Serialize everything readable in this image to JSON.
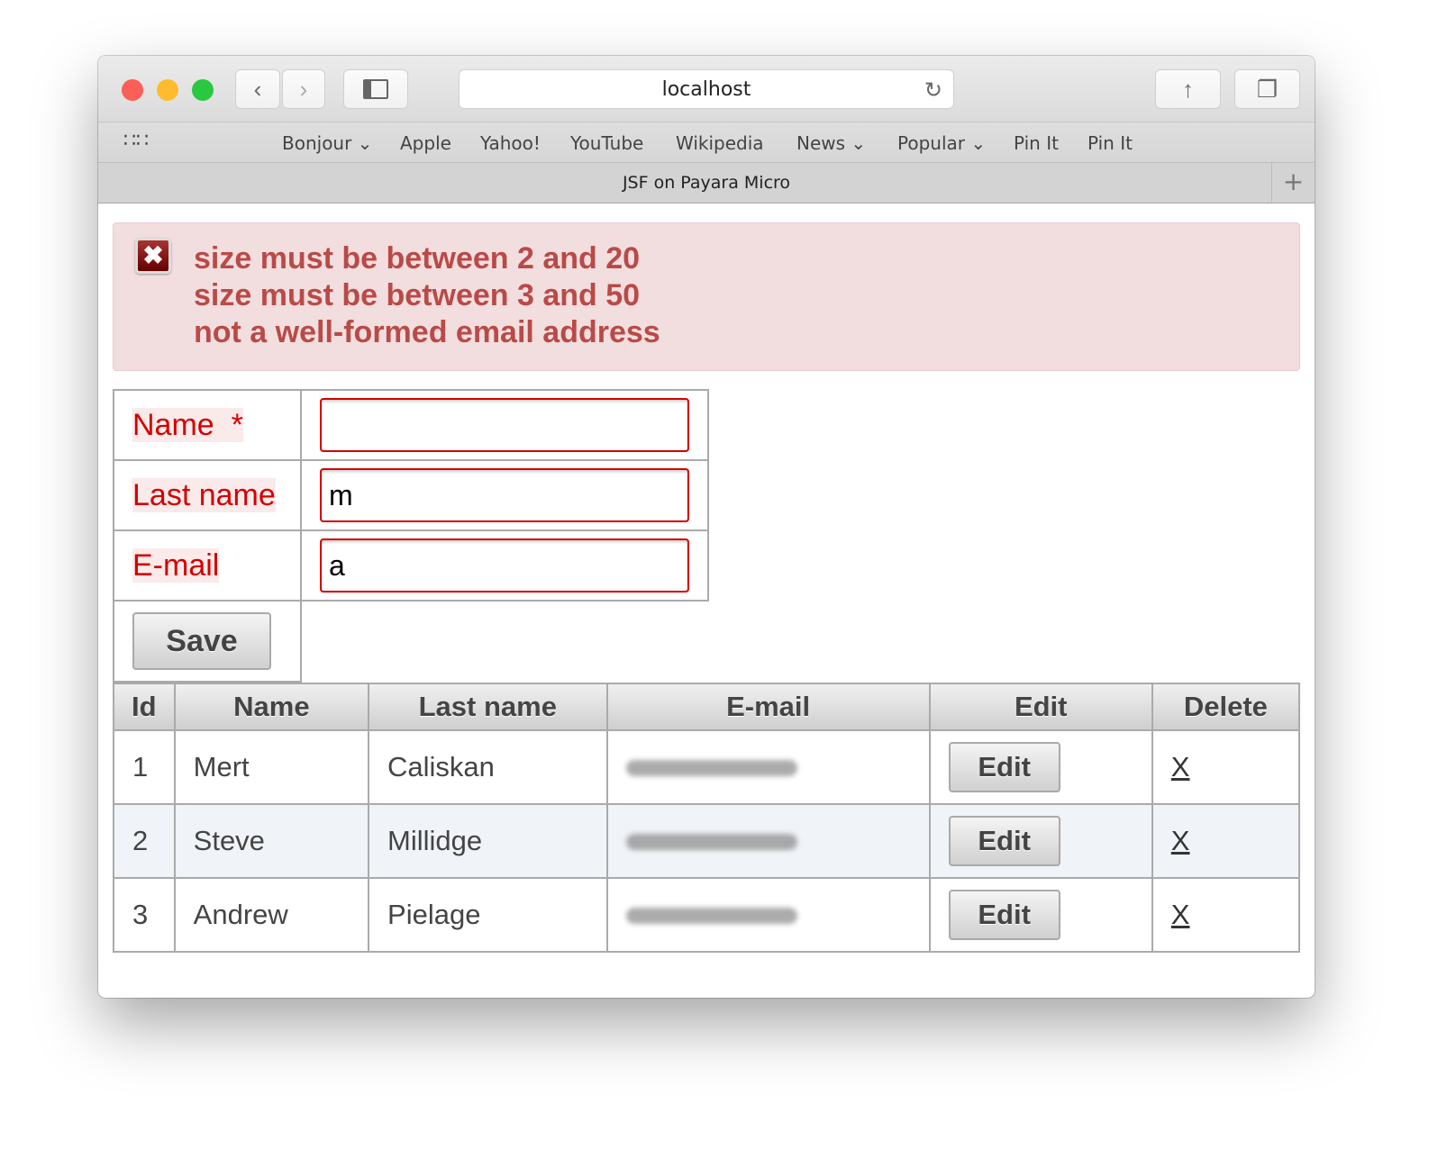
{
  "browser": {
    "url": "localhost",
    "tab_title": "JSF on Payara Micro",
    "bookmarks": [
      {
        "label": "Bonjour",
        "menu": true
      },
      {
        "label": "Apple"
      },
      {
        "label": "Yahoo!"
      },
      {
        "label": "YouTube"
      },
      {
        "label": "Wikipedia"
      },
      {
        "label": "News",
        "menu": true
      },
      {
        "label": "Popular",
        "menu": true
      },
      {
        "label": "Pin It"
      },
      {
        "label": "Pin It"
      }
    ]
  },
  "errors": [
    "size must be between 2 and 20",
    "size must be between 3 and 50",
    "not a well-formed email address"
  ],
  "form": {
    "name_label": "Name  *",
    "name_value": "",
    "lastname_label": "Last name",
    "lastname_value": "m",
    "email_label": "E-mail",
    "email_value": "a",
    "save_label": "Save"
  },
  "table": {
    "headers": [
      "Id",
      "Name",
      "Last name",
      "E-mail",
      "Edit",
      "Delete"
    ],
    "rows": [
      {
        "id": "1",
        "name": "Mert",
        "last": "Caliskan"
      },
      {
        "id": "2",
        "name": "Steve",
        "last": "Millidge"
      },
      {
        "id": "3",
        "name": "Andrew",
        "last": "Pielage"
      }
    ],
    "edit_label": "Edit",
    "delete_label": "X"
  }
}
